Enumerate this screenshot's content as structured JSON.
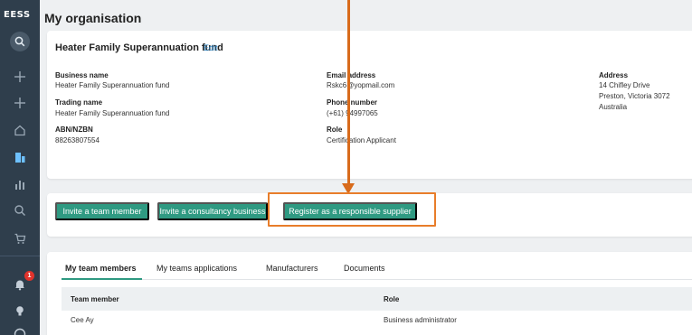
{
  "brand": {
    "name": "EESS"
  },
  "page": {
    "title": "My organisation"
  },
  "org": {
    "name": "Heater Family Superannuation fund",
    "edit_label": "Edit",
    "fields": {
      "business_name": {
        "label": "Business name",
        "value": "Heater Family Superannuation fund"
      },
      "trading_name": {
        "label": "Trading name",
        "value": "Heater Family Superannuation fund"
      },
      "abn": {
        "label": "ABN/NZBN",
        "value": "88263807554"
      },
      "email": {
        "label": "Email address",
        "value": "Rskc6@yopmail.com"
      },
      "phone": {
        "label": "Phone number",
        "value": "(+61) 94997065"
      },
      "role": {
        "label": "Role",
        "value": "Certification Applicant"
      },
      "address": {
        "label": "Address",
        "line1": "14 Chifley Drive",
        "line2": "Preston, Victoria 3072",
        "line3": "Australia"
      }
    }
  },
  "actions": {
    "invite_team": "Invite a team member",
    "invite_consultancy": "Invite a consultancy business",
    "register_supplier": "Register as a responsible supplier"
  },
  "tabs": [
    {
      "label": "My team members",
      "active": true
    },
    {
      "label": "My teams applications",
      "active": false
    },
    {
      "label": "Manufacturers",
      "active": false
    },
    {
      "label": "Documents",
      "active": false
    }
  ],
  "table": {
    "headers": {
      "member": "Team member",
      "role": "Role"
    },
    "rows": [
      {
        "member": "Cee Ay",
        "role": "Business administrator"
      }
    ]
  },
  "notifications": {
    "count": "1"
  },
  "colors": {
    "sidebar": "#2f3e4c",
    "accent": "#2f9a82",
    "highlight": "#e87d2a",
    "link": "#2a86c8"
  }
}
